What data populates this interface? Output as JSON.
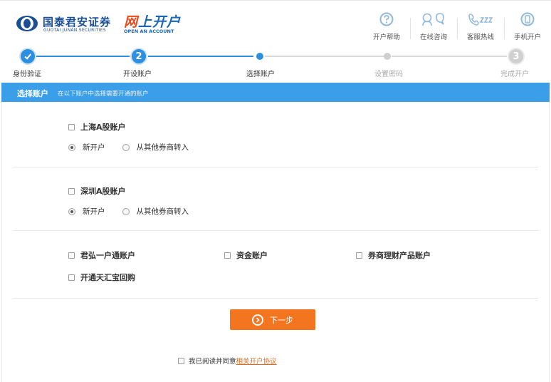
{
  "brand": {
    "name_cn": "国泰君安证券",
    "name_en": "GUOTAI JUNAN SECURITIES",
    "product_cn_prefix": "网",
    "product_cn_rest": "上开户",
    "product_en": "OPEN AN ACCOUNT"
  },
  "header_links": [
    {
      "label": "开户帮助",
      "icon": "question-icon"
    },
    {
      "label": "在线咨询",
      "icon": "chat-icon"
    },
    {
      "label": "客服热线",
      "icon": "hotline-icon"
    },
    {
      "label": "手机开户",
      "icon": "mobile-icon"
    }
  ],
  "steps": [
    {
      "label": "身份验证",
      "state": "done"
    },
    {
      "label": "开设账户",
      "state": "done",
      "number": "2"
    },
    {
      "label": "选择账户",
      "state": "current"
    },
    {
      "label": "设置密码",
      "state": "todo"
    },
    {
      "label": "完成开户",
      "state": "todo",
      "number": "3"
    }
  ],
  "section": {
    "title": "选择账户",
    "desc": "在以下账户中选择需要开通的账户"
  },
  "accounts": {
    "shanghai": {
      "label": "上海A股账户",
      "opt_new": "新开户",
      "opt_transfer": "从其他券商转入",
      "selected": "new",
      "checked": false
    },
    "shenzhen": {
      "label": "深圳A股账户",
      "opt_new": "新开户",
      "opt_transfer": "从其他券商转入",
      "selected": "new",
      "checked": false
    },
    "others": [
      {
        "label": "君弘一户通账户",
        "checked": false
      },
      {
        "label": "资金账户",
        "checked": false
      },
      {
        "label": "券商理财产品账户",
        "checked": false
      },
      {
        "label": "开通天汇宝回购",
        "checked": false
      }
    ]
  },
  "next_button": {
    "label": "下一步"
  },
  "agreement": {
    "text": "我已阅读并同意",
    "link": "相关开户协议",
    "checked": false
  },
  "colors": {
    "primary_blue": "#3b9ee8",
    "brand_blue": "#1b4f93",
    "accent_orange": "#f4751f",
    "step_gray": "#d0d0d0"
  }
}
